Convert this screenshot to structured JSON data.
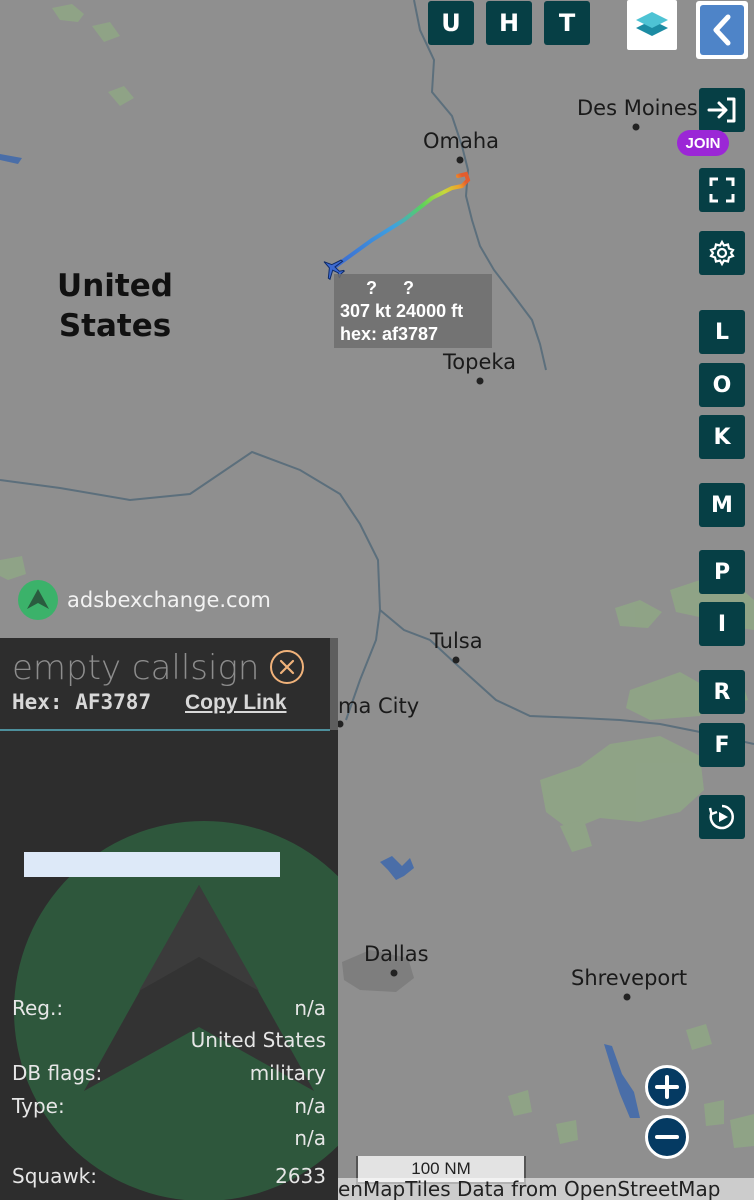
{
  "map": {
    "country": "United States",
    "cities": {
      "des_moines": "Des Moines",
      "omaha": "Omaha",
      "topeka": "Topeka",
      "tulsa": "Tulsa",
      "okc": "ma City",
      "dallas": "Dallas",
      "shreveport": "Shreveport"
    },
    "aircraft_label": {
      "line1_a": "?",
      "line1_b": "?",
      "line2": "307 kt  24000 ft",
      "line3": "hex: af3787"
    },
    "brand": "adsbexchange.com",
    "scale_label": "100 NM",
    "attribution": "enMapTiles Data from OpenStreetMap"
  },
  "toolbar": {
    "top_buttons": [
      "U",
      "H",
      "T"
    ],
    "join_label": "JOIN",
    "side_buttons": [
      "L",
      "O",
      "K",
      "M",
      "P",
      "I",
      "R",
      "F"
    ]
  },
  "panel": {
    "title": "empty callsign",
    "hex_label": "Hex:",
    "hex_value": "AF3787",
    "copy_link": "Copy Link",
    "rows": {
      "reg_key": "Reg.:",
      "reg_val": "n/a",
      "country_val": "United States",
      "dbflags_key": "DB flags:",
      "dbflags_val": "military",
      "type_key": "Type:",
      "type_val": "n/a",
      "type2_val": "n/a",
      "squawk_key": "Squawk:",
      "squawk_val": "2633"
    }
  },
  "colors": {
    "button_bg": "#063f45",
    "join_bg": "#9b27d6",
    "zoom_bg": "#053a62",
    "map_bg": "#8f8f8f",
    "panel_bg": "#2d2d2d"
  }
}
